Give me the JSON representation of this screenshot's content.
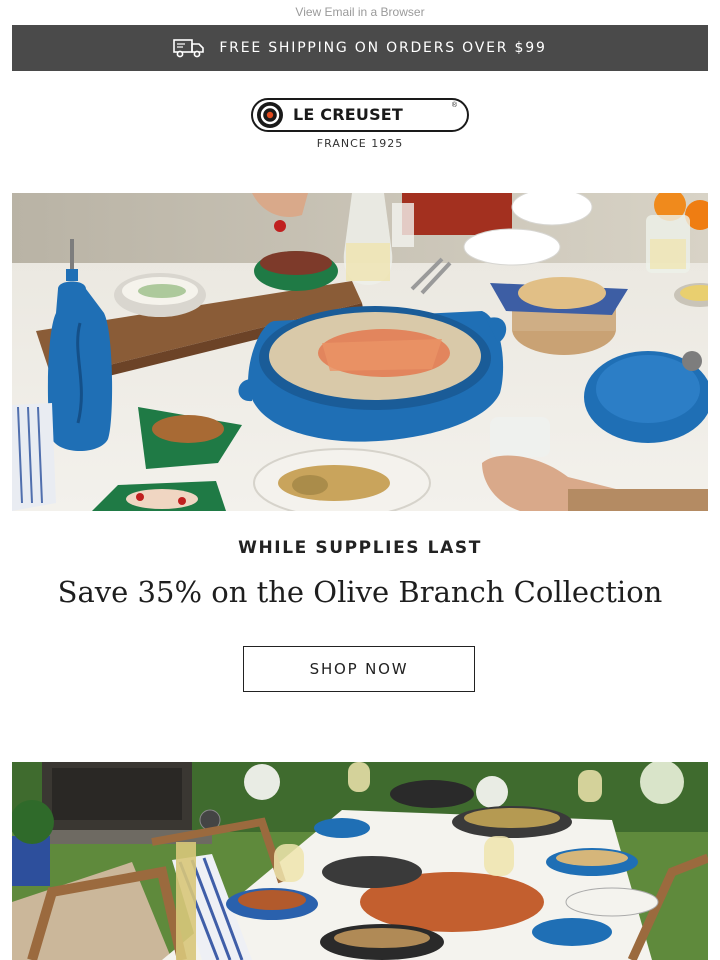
{
  "preheader": {
    "view_in_browser": "View Email in a Browser"
  },
  "shipping_bar": {
    "icon": "truck-icon",
    "text": "FREE SHIPPING ON ORDERS OVER $99"
  },
  "brand": {
    "name": "LE CREUSET",
    "registered": "®",
    "tagline": "FRANCE 1925"
  },
  "hero": {
    "description": "Table set with blue Le Creuset braiser of salmon and rice, blue oil cruet, green serving dishes"
  },
  "promo": {
    "eyebrow": "WHILE SUPPLIES LAST",
    "headline": "Save 35% on the Olive Branch Collection",
    "cta_label": "SHOP NOW"
  },
  "hero2": {
    "description": "Outdoor garden dinner table with seafood, blue cookware and wine glasses"
  },
  "colors": {
    "bar_bg": "#4a4a4a",
    "cookware_blue": "#1f6fb5",
    "dish_green": "#1f7a45",
    "text_dark": "#222222"
  }
}
